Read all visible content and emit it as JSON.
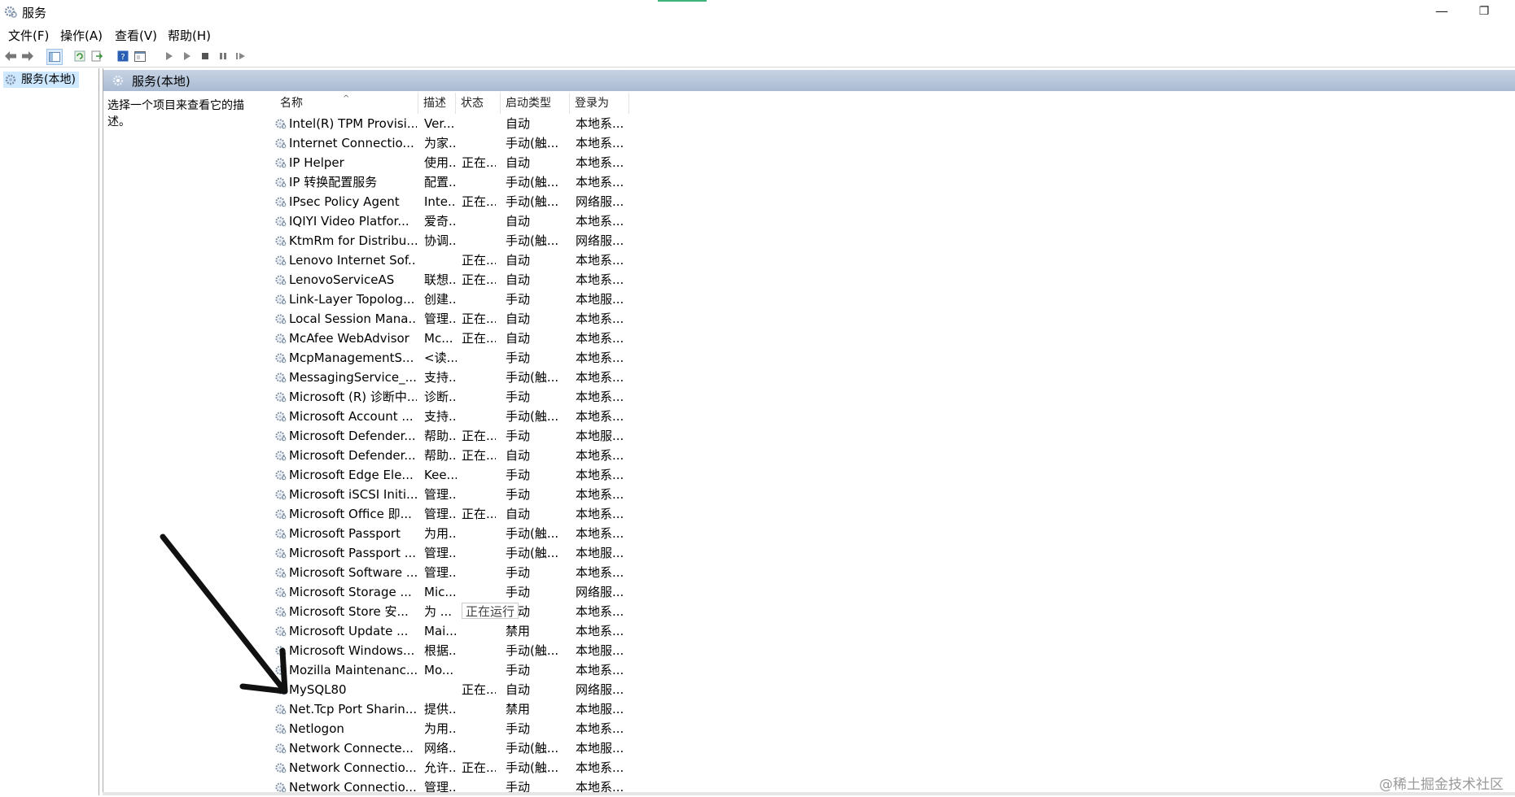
{
  "window": {
    "title": "服务",
    "minimize_glyph": "—",
    "restore_glyph": "❐"
  },
  "menu": [
    "文件(F)",
    "操作(A)",
    "查看(V)",
    "帮助(H)"
  ],
  "toolbar": [
    "back-icon",
    "forward-icon",
    "show-tree-icon",
    "refresh-icon",
    "export-icon",
    "help-icon",
    "properties-icon",
    "start-service-icon",
    "start-alt-icon",
    "stop-service-icon",
    "pause-service-icon",
    "restart-service-icon"
  ],
  "tree": {
    "item": "服务(本地)"
  },
  "panel": {
    "header": "服务(本地)",
    "description": "选择一个项目来查看它的描述。",
    "columns": [
      "名称",
      "描述",
      "状态",
      "启动类型",
      "登录为"
    ],
    "sort_indicator": "^",
    "rows": [
      {
        "name": "Intel(R) TPM Provisi...",
        "desc": "Ver...",
        "status": "",
        "startup": "自动",
        "logon": "本地系..."
      },
      {
        "name": "Internet Connectio...",
        "desc": "为家...",
        "status": "",
        "startup": "手动(触...",
        "logon": "本地系..."
      },
      {
        "name": "IP Helper",
        "desc": "使用...",
        "status": "正在...",
        "startup": "自动",
        "logon": "本地系..."
      },
      {
        "name": "IP 转换配置服务",
        "desc": "配置...",
        "status": "",
        "startup": "手动(触...",
        "logon": "本地系..."
      },
      {
        "name": "IPsec Policy Agent",
        "desc": "Inte...",
        "status": "正在...",
        "startup": "手动(触...",
        "logon": "网络服..."
      },
      {
        "name": "IQIYI Video Platfor...",
        "desc": "爱奇...",
        "status": "",
        "startup": "自动",
        "logon": "本地系..."
      },
      {
        "name": "KtmRm for Distribu...",
        "desc": "协调...",
        "status": "",
        "startup": "手动(触...",
        "logon": "网络服..."
      },
      {
        "name": "Lenovo Internet Sof...",
        "desc": "",
        "status": "正在...",
        "startup": "自动",
        "logon": "本地系..."
      },
      {
        "name": "LenovoServiceAS",
        "desc": "联想...",
        "status": "正在...",
        "startup": "自动",
        "logon": "本地系..."
      },
      {
        "name": "Link-Layer Topolog...",
        "desc": "创建...",
        "status": "",
        "startup": "手动",
        "logon": "本地服..."
      },
      {
        "name": "Local Session Mana...",
        "desc": "管理...",
        "status": "正在...",
        "startup": "自动",
        "logon": "本地系..."
      },
      {
        "name": "McAfee WebAdvisor",
        "desc": "Mc...",
        "status": "正在...",
        "startup": "自动",
        "logon": "本地系..."
      },
      {
        "name": "McpManagementS...",
        "desc": "<读...",
        "status": "",
        "startup": "手动",
        "logon": "本地系..."
      },
      {
        "name": "MessagingService_...",
        "desc": "支持...",
        "status": "",
        "startup": "手动(触...",
        "logon": "本地系..."
      },
      {
        "name": "Microsoft (R) 诊断中...",
        "desc": "诊断...",
        "status": "",
        "startup": "手动",
        "logon": "本地系..."
      },
      {
        "name": "Microsoft Account ...",
        "desc": "支持...",
        "status": "",
        "startup": "手动(触...",
        "logon": "本地系..."
      },
      {
        "name": "Microsoft Defender...",
        "desc": "帮助...",
        "status": "正在...",
        "startup": "手动",
        "logon": "本地服..."
      },
      {
        "name": "Microsoft Defender...",
        "desc": "帮助...",
        "status": "正在...",
        "startup": "自动",
        "logon": "本地系..."
      },
      {
        "name": "Microsoft Edge Ele...",
        "desc": "Kee...",
        "status": "",
        "startup": "手动",
        "logon": "本地系..."
      },
      {
        "name": "Microsoft iSCSI Initi...",
        "desc": "管理...",
        "status": "",
        "startup": "手动",
        "logon": "本地系..."
      },
      {
        "name": "Microsoft Office 即...",
        "desc": "管理...",
        "status": "正在...",
        "startup": "自动",
        "logon": "本地系..."
      },
      {
        "name": "Microsoft Passport",
        "desc": "为用...",
        "status": "",
        "startup": "手动(触...",
        "logon": "本地系..."
      },
      {
        "name": "Microsoft Passport ...",
        "desc": "管理...",
        "status": "",
        "startup": "手动(触...",
        "logon": "本地服..."
      },
      {
        "name": "Microsoft Software ...",
        "desc": "管理...",
        "status": "",
        "startup": "手动",
        "logon": "本地系..."
      },
      {
        "name": "Microsoft Storage ...",
        "desc": "Mic...",
        "status": "",
        "startup": "手动",
        "logon": "网络服..."
      },
      {
        "name": "Microsoft Store 安...",
        "desc": "为 ...",
        "status": "正在运行",
        "startup": "手动",
        "logon": "本地系..."
      },
      {
        "name": "Microsoft Update ...",
        "desc": "Mai...",
        "status": "",
        "startup": "禁用",
        "logon": "本地系..."
      },
      {
        "name": "Microsoft Windows...",
        "desc": "根据...",
        "status": "",
        "startup": "手动(触...",
        "logon": "本地服..."
      },
      {
        "name": "Mozilla Maintenanc...",
        "desc": "Mo...",
        "status": "",
        "startup": "手动",
        "logon": "本地系..."
      },
      {
        "name": "MySQL80",
        "desc": "",
        "status": "正在...",
        "startup": "自动",
        "logon": "网络服..."
      },
      {
        "name": "Net.Tcp Port Sharin...",
        "desc": "提供...",
        "status": "",
        "startup": "禁用",
        "logon": "本地服..."
      },
      {
        "name": "Netlogon",
        "desc": "为用...",
        "status": "",
        "startup": "手动",
        "logon": "本地系..."
      },
      {
        "name": "Network Connecte...",
        "desc": "网络...",
        "status": "",
        "startup": "手动(触...",
        "logon": "本地服..."
      },
      {
        "name": "Network Connectio...",
        "desc": "允许...",
        "status": "正在...",
        "startup": "手动(触...",
        "logon": "本地系..."
      },
      {
        "name": "Network Connectio...",
        "desc": "管理...",
        "status": "",
        "startup": "手动",
        "logon": "本地系..."
      }
    ]
  },
  "annotation": {
    "type": "arrow",
    "points_to_row": "MySQL80",
    "color": "#111111"
  },
  "watermark": "@稀土掘金技术社区",
  "colors": {
    "selection": "#cde8ff",
    "header_gradient_top": "#c6d3e4",
    "header_gradient_bottom": "#a9bbd2",
    "accent": "#3db37a"
  }
}
